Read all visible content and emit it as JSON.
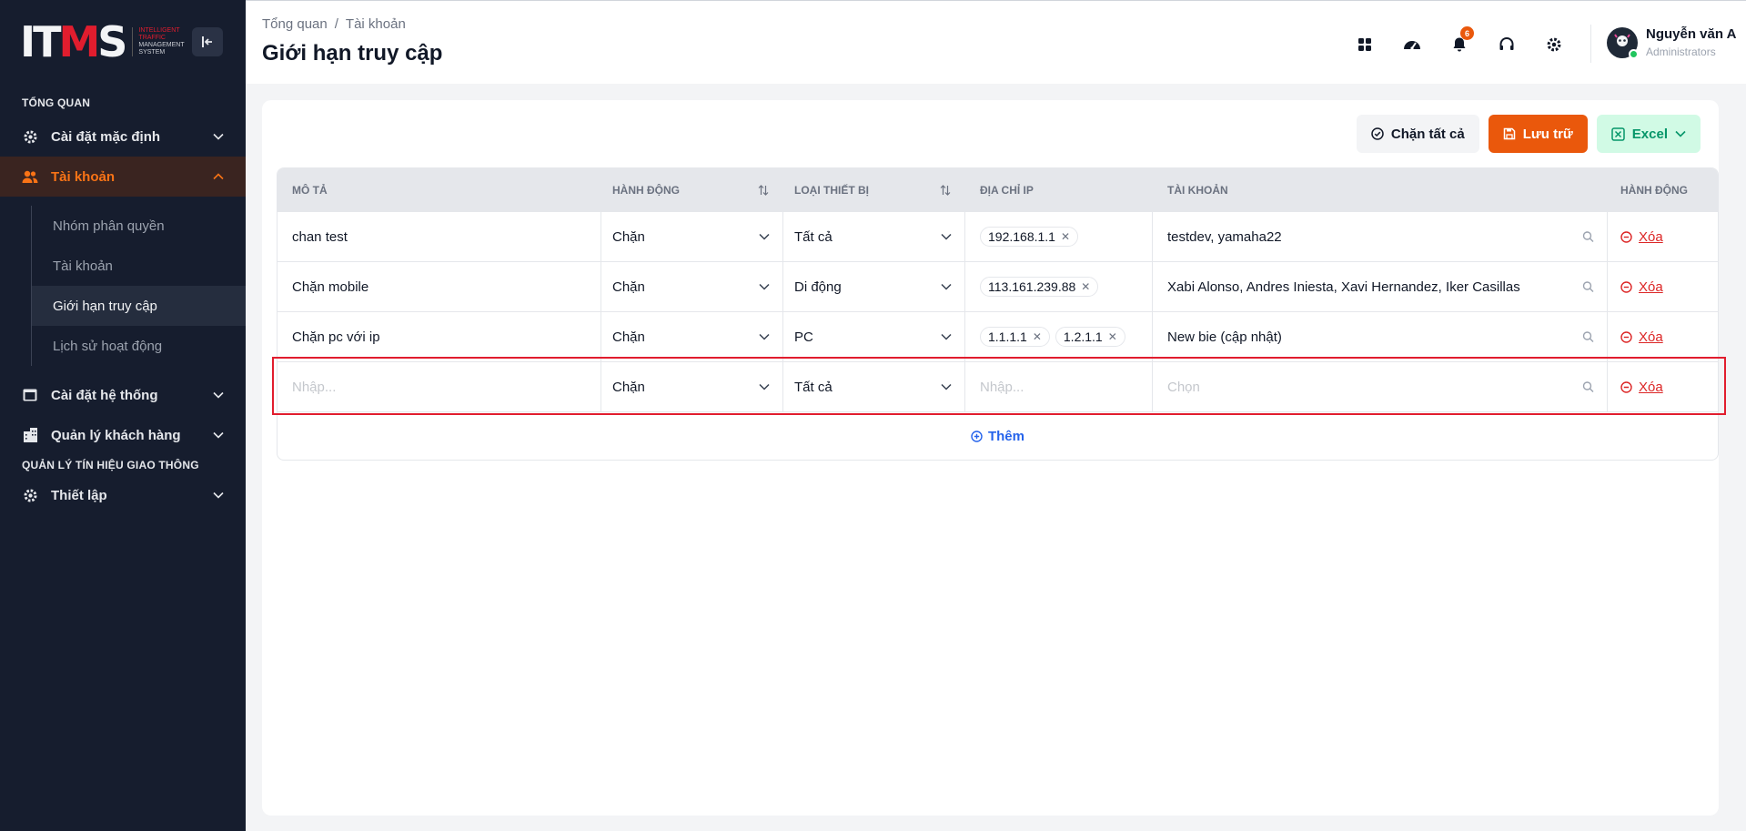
{
  "brand": {
    "logo_text": "ITMS",
    "logo_lines": [
      "INTELLIGENT",
      "TRAFFIC",
      "MANAGEMENT",
      "SYSTEM"
    ]
  },
  "sidebar": {
    "section1": "TỔNG QUAN",
    "section2": "QUẢN LÝ TÍN HIỆU GIAO THÔNG",
    "items": [
      {
        "label": "Cài đặt mặc định",
        "icon": "gear-icon"
      },
      {
        "label": "Tài khoản",
        "icon": "users-icon",
        "active": true
      },
      {
        "label": "Cài đặt hệ thống",
        "icon": "window-icon"
      },
      {
        "label": "Quản lý khách hàng",
        "icon": "building-icon"
      },
      {
        "label": "Thiết lập",
        "icon": "gear-icon"
      }
    ],
    "subitems": [
      {
        "label": "Nhóm phân quyền"
      },
      {
        "label": "Tài khoản"
      },
      {
        "label": "Giới hạn truy cập",
        "active": true
      },
      {
        "label": "Lịch sử hoạt động"
      }
    ]
  },
  "header": {
    "breadcrumb": [
      "Tổng quan",
      "Tài khoản"
    ],
    "breadcrumb_sep": "/",
    "title": "Giới hạn truy cập",
    "notification_count": "6",
    "user_name": "Nguyễn văn A",
    "user_role": "Administrators"
  },
  "toolbar": {
    "block_all": "Chặn tất cả",
    "save": "Lưu trữ",
    "excel": "Excel"
  },
  "table": {
    "headers": [
      "MÔ TẢ",
      "HÀNH ĐỘNG",
      "LOẠI THIẾT BỊ",
      "ĐỊA CHỈ IP",
      "TÀI KHOẢN",
      "HÀNH ĐỘNG"
    ],
    "rows": [
      {
        "desc": "chan test",
        "action": "Chặn",
        "device": "Tất cả",
        "ips": [
          "192.168.1.1"
        ],
        "accounts": "testdev, yamaha22",
        "delete": "Xóa"
      },
      {
        "desc": "Chặn mobile",
        "action": "Chặn",
        "device": "Di động",
        "ips": [
          "113.161.239.88"
        ],
        "accounts": "Xabi Alonso, Andres Iniesta, Xavi Hernandez, Iker Casillas",
        "delete": "Xóa"
      },
      {
        "desc": "Chặn pc với ip",
        "action": "Chặn",
        "device": "PC",
        "ips": [
          "1.1.1.1",
          "1.2.1.1"
        ],
        "accounts": "New bie (cập nhật)",
        "delete": "Xóa"
      }
    ],
    "new_row": {
      "desc_placeholder": "Nhập...",
      "action": "Chặn",
      "device": "Tất cả",
      "ip_placeholder": "Nhập...",
      "account_placeholder": "Chọn",
      "delete": "Xóa"
    },
    "add_label": "Thêm"
  },
  "colors": {
    "accent": "#ea580c",
    "sidebar_bg": "#161d2e",
    "highlight": "#e11d2e",
    "link": "#2563eb",
    "danger": "#dc2626"
  }
}
